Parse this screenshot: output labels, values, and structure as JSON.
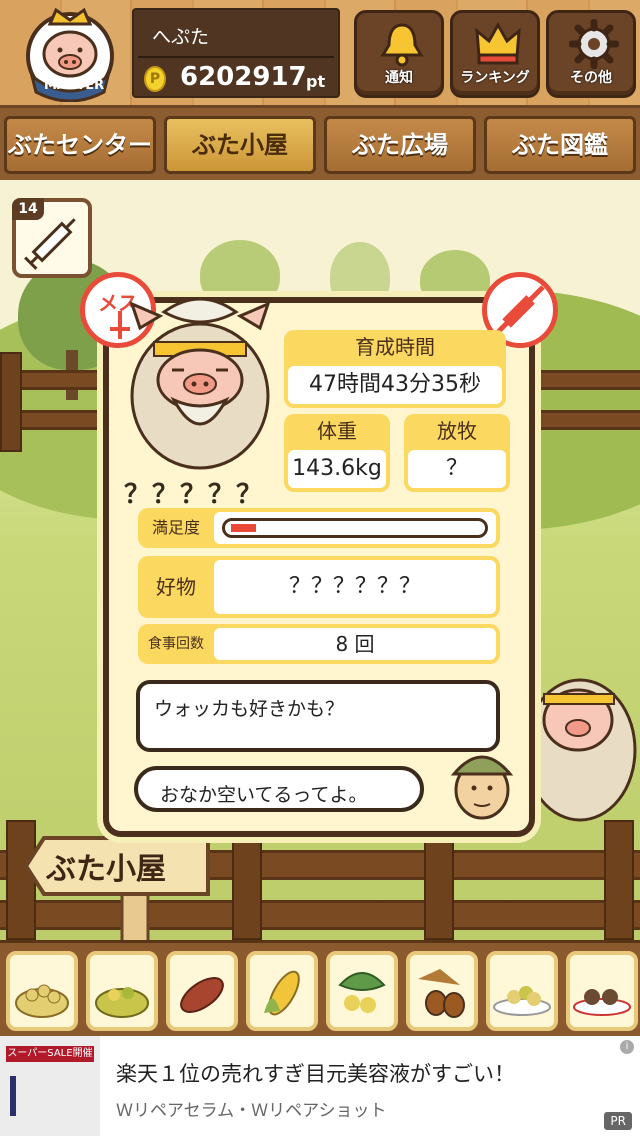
{
  "header": {
    "rank_label": "MASTER",
    "player_name": "へぷた",
    "points_value": "6202917",
    "points_unit": "pt",
    "coin_symbol": "P",
    "buttons": [
      {
        "label": "通知",
        "icon": "bell-icon"
      },
      {
        "label": "ランキング",
        "icon": "crown-icon"
      },
      {
        "label": "その他",
        "icon": "gear-icon"
      }
    ]
  },
  "tabs": [
    {
      "label": "ぶたセンター",
      "active": false
    },
    {
      "label": "ぶた小屋",
      "active": true
    },
    {
      "label": "ぶた広場",
      "active": false
    },
    {
      "label": "ぶた図鑑",
      "active": false
    }
  ],
  "item": {
    "count": "14",
    "icon": "syringe-icon"
  },
  "pig": {
    "sex_label": "メス",
    "name": "？？？？？",
    "raising_time_label": "育成時間",
    "raising_time_value": "47時間43分35秒",
    "weight_label": "体重",
    "weight_value": "143.6kg",
    "grazing_label": "放牧",
    "grazing_value": "？",
    "satisfaction_label": "満足度",
    "satisfaction_level": 0.1,
    "favorite_label": "好物",
    "favorite_value": "？？？？？？",
    "meals_label": "食事回数",
    "meals_value": "8 回",
    "pig_speech": "ウォッカも好きかも？",
    "farmer_speech": "おなか空いてるってよ。"
  },
  "sign_label": "ぶた小屋",
  "foods": [
    "grain-icon",
    "grain-mixed-icon",
    "sweet-potato-icon",
    "corn-icon",
    "vegetable-icon",
    "acorn-icon",
    "grain-plate-icon",
    "meatball-plate-icon"
  ],
  "ad": {
    "banner_text": "スーパーSALE開催",
    "title": "楽天１位の売れすぎ目元美容液がすごい！",
    "subtitle": "Ｗリペアセラム・Ｗリペアショット",
    "pr_label": "PR",
    "info_label": "i"
  },
  "colors": {
    "accent": "#fbd85f",
    "wood": "#8a5a2e",
    "warning": "#e94b3b"
  }
}
